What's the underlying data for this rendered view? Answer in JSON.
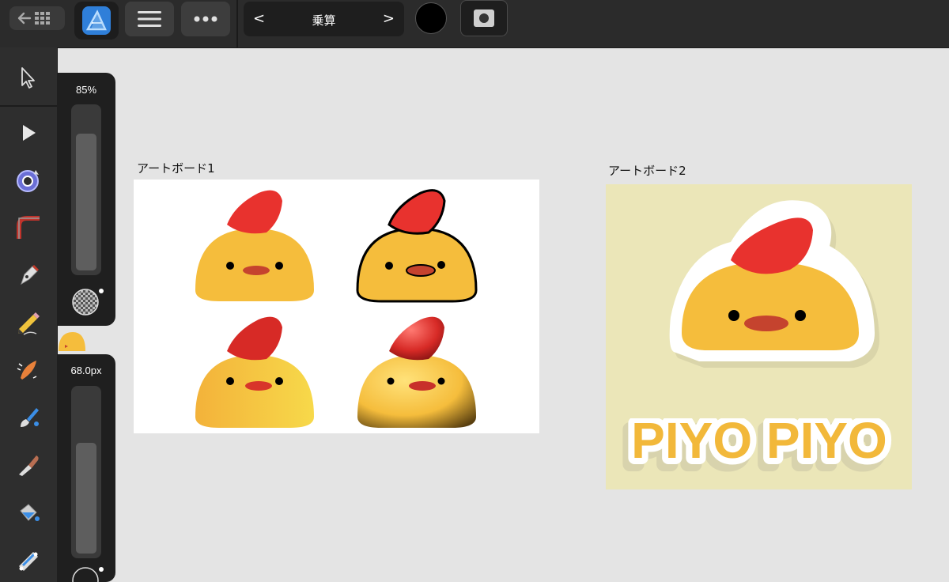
{
  "toolbar_top": {
    "back_icon": "back-arrow-grid-icon",
    "app_icon": "affinity-designer-logo",
    "menu_icon": "hamburger-icon",
    "more_icon": "more-dots-icon",
    "blend_mode": {
      "label": "乗算",
      "prev": "<",
      "next": ">"
    },
    "fill_color": "#000000",
    "mask_icon": "mask-icon"
  },
  "tools": [
    {
      "name": "move-tool",
      "icon": "arrow-pointer-icon"
    },
    {
      "name": "node-tool",
      "icon": "node-pointer-icon"
    },
    {
      "name": "point-transform-tool",
      "icon": "point-transform-icon"
    },
    {
      "name": "corner-tool",
      "icon": "corner-icon"
    },
    {
      "name": "pen-tool",
      "icon": "pen-nib-icon"
    },
    {
      "name": "pencil-tool",
      "icon": "pencil-icon"
    },
    {
      "name": "vector-brush-tool",
      "icon": "vector-brush-icon"
    },
    {
      "name": "paint-brush-tool",
      "icon": "paint-brush-icon"
    },
    {
      "name": "knife-tool",
      "icon": "knife-icon"
    },
    {
      "name": "fill-tool",
      "icon": "fill-bucket-icon"
    },
    {
      "name": "transparency-tool",
      "icon": "gradient-ruler-icon"
    }
  ],
  "opacity_slider": {
    "value_text": "85%",
    "level": 0.85
  },
  "width_slider": {
    "value_text": "68.0px",
    "level": 0.68
  },
  "artboards": [
    {
      "label": "アートボード1"
    },
    {
      "label": "アートボード2",
      "text": "PIYO PIYO"
    }
  ],
  "colors": {
    "chick_body": "#f5bd3c",
    "chick_crest": "#e8322e",
    "beak": "#c5432e",
    "artboard2_bg": "#ebe6b8",
    "piyo_text": "#f2b83a"
  }
}
